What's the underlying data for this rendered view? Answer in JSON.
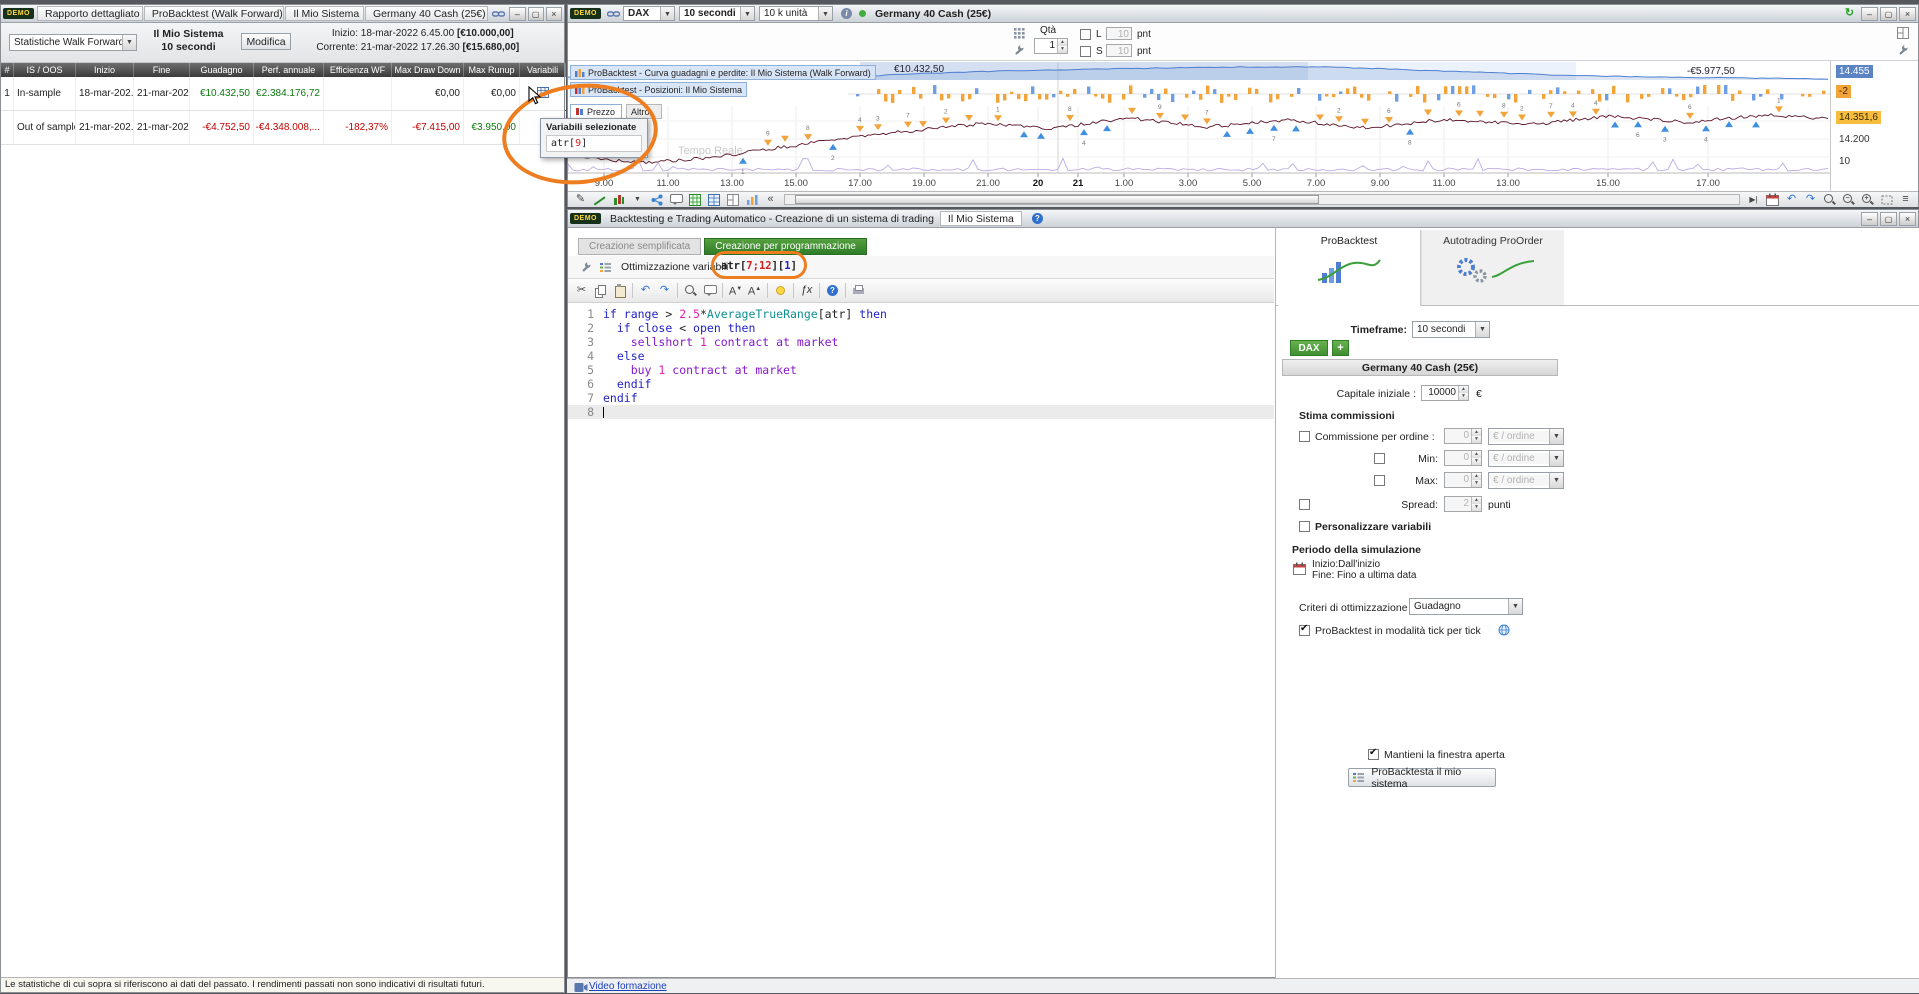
{
  "brand": "DEMO",
  "report_window": {
    "title_tabs": [
      "Rapporto dettagliato",
      "ProBacktest (Walk Forward)",
      "Il Mio Sistema",
      "Germany 40 Cash (25€)"
    ],
    "stats_selector": "Statistiche Walk Forward",
    "system_name": "Il Mio Sistema",
    "system_timeframe": "10 secondi",
    "modify_button": "Modifica",
    "start_label": "Inizio:",
    "start_value": "18-mar-2022 6.45.00",
    "start_capital": "[€10.000,00]",
    "current_label": "Corrente:",
    "current_value": "21-mar-2022 17.26.30",
    "current_capital": "[€15.680,00]",
    "table": {
      "headers": [
        "#",
        "IS / OOS",
        "Inizio",
        "Fine",
        "Guadagno",
        "Perf. annuale",
        "Efficienza WF",
        "Max Draw Down",
        "Max Runup",
        "Variabili"
      ],
      "rows": [
        {
          "num": "1",
          "type": "In-sample",
          "start": "18-mar-202...",
          "end": "21-mar-202...",
          "gain": "€10.432,50",
          "gain_color": "pos",
          "annual": "€2.384.176,72",
          "annual_color": "pos",
          "efficiency": "",
          "efficiency_color": "",
          "dd": "€0,00",
          "dd_color": "",
          "runup": "€0,00",
          "runup_color": "",
          "has_icon": true
        },
        {
          "num": "",
          "type": "Out of sample",
          "start": "21-mar-202...",
          "end": "21-mar-202...",
          "gain": "-€4.752,50",
          "gain_color": "neg",
          "annual": "-€4.348.008,...",
          "annual_color": "neg",
          "efficiency": "-182,37%",
          "efficiency_color": "neg",
          "dd": "-€7.415,00",
          "dd_color": "neg",
          "runup": "€3.950,00",
          "runup_color": "pos",
          "has_icon": false
        }
      ]
    },
    "variables_popup": {
      "title": "Variabili selezionate",
      "item_tokens": [
        [
          "p",
          "atr["
        ],
        [
          "r",
          "9"
        ],
        [
          "p",
          "]"
        ]
      ]
    },
    "disclaimer": "Le statistiche di cui sopra si riferiscono ai dati del passato. I rendimenti passati non sono indicativi di risultati futuri."
  },
  "chart_window": {
    "symbol": "DAX",
    "timeframe": "10 secondi",
    "units": "10 k unità",
    "instrument": "Germany 40 Cash (25€)",
    "qty_label": "Qtà",
    "qty_value": "1",
    "long_label": "L",
    "long_value": "10",
    "short_label": "S",
    "short_value": "10",
    "pnt_label": "pnt",
    "overlay_equity": "ProBacktest - Curva guadagni e perdite: Il Mio Sistema (Walk Forward)",
    "overlay_positions": "ProBacktest - Posizioni: Il Mio Sistema",
    "tab_price": "Prezzo",
    "tab_other": "Altro",
    "equity_gain_label": "€10.432,50",
    "equity_loss_label": "-€5.977,50",
    "watermark": "Tempo Reale",
    "y_labels": [
      {
        "text": "14.455",
        "style": "blue"
      },
      {
        "text": "-2",
        "style": "orange"
      },
      {
        "text": "14.351,6",
        "style": "yellow"
      },
      {
        "text": "14.200",
        "style": "plain"
      },
      {
        "text": "10",
        "style": "plain"
      }
    ],
    "x_ticks": [
      {
        "label": "9.00"
      },
      {
        "label": "11.00"
      },
      {
        "label": "13.00"
      },
      {
        "label": "15.00"
      },
      {
        "label": "17.00"
      },
      {
        "label": "19.00"
      },
      {
        "label": "21.00"
      },
      {
        "label": "20",
        "bold": true
      },
      {
        "label": "21",
        "bold": true
      },
      {
        "label": "1.00"
      },
      {
        "label": "3.00"
      },
      {
        "label": "5.00"
      },
      {
        "label": "7.00"
      },
      {
        "label": "9.00"
      },
      {
        "label": "11.00"
      },
      {
        "label": "13.00"
      },
      {
        "label": "15.00"
      },
      {
        "label": "17.00"
      }
    ],
    "toolbar_left_icons": [
      "draw-icon",
      "trendline-icon",
      "chart-type-icon",
      "chart-type-menu-icon",
      "share-icon",
      "comment-icon",
      "backtest-table-icon",
      "positions-table-icon",
      "layout-icon",
      "statistics-icon",
      "collapse-icon"
    ],
    "toolbar_right_icons": [
      "step-forward-icon",
      "calendar-icon",
      "undo-icon",
      "redo-icon",
      "zoom-reset-icon",
      "zoom-out-icon",
      "zoom-in-icon",
      "zoom-select-icon",
      "menu-icon"
    ],
    "side_icons": [
      "keypad-icon",
      "wrench-icon"
    ]
  },
  "editor_window": {
    "title": "Backtesting e Trading Automatico - Creazione di un sistema di trading",
    "doc_tab": "Il Mio Sistema",
    "tab_simple": "Creazione semplificata",
    "tab_programming": "Creazione per programmazione",
    "optimization_label": "Ottimizzazione variabili",
    "optimization_tokens": [
      [
        "p",
        "atr["
      ],
      [
        "r",
        "7;12"
      ],
      [
        "p",
        "]["
      ],
      [
        "k",
        "1"
      ],
      [
        "p",
        "]"
      ]
    ],
    "toolbar_icons": [
      "cut-icon",
      "copy-icon",
      "paste-icon",
      "undo-icon",
      "redo-icon",
      "search-icon",
      "comment-icon",
      "font-decrease-icon",
      "font-increase-icon",
      "hint-icon",
      "function-icon",
      "help-icon",
      "print-icon"
    ],
    "code_lines": [
      [
        [
          "k",
          "if "
        ],
        [
          "k",
          "range"
        ],
        [
          "p",
          " > "
        ],
        [
          "n",
          "2.5"
        ],
        [
          "p",
          "*"
        ],
        [
          "f",
          "AverageTrueRange"
        ],
        [
          "p",
          "["
        ],
        [
          "p",
          "atr"
        ],
        [
          "p",
          "] "
        ],
        [
          "k",
          "then"
        ]
      ],
      [
        [
          "p",
          "  "
        ],
        [
          "k",
          "if "
        ],
        [
          "k",
          "close"
        ],
        [
          "p",
          " < "
        ],
        [
          "k",
          "open"
        ],
        [
          "p",
          " "
        ],
        [
          "k",
          "then"
        ]
      ],
      [
        [
          "p",
          "    "
        ],
        [
          "o",
          "sellshort "
        ],
        [
          "n",
          "1"
        ],
        [
          "o",
          " contract at market"
        ]
      ],
      [
        [
          "p",
          "  "
        ],
        [
          "k",
          "else"
        ]
      ],
      [
        [
          "p",
          "    "
        ],
        [
          "o",
          "buy "
        ],
        [
          "n",
          "1"
        ],
        [
          "o",
          " contract at market"
        ]
      ],
      [
        [
          "p",
          "  "
        ],
        [
          "k",
          "endif"
        ]
      ],
      [
        [
          "k",
          "endif"
        ]
      ],
      []
    ]
  },
  "config_panel": {
    "tab_probacktest": "ProBacktest",
    "tab_proorder": "Autotrading ProOrder",
    "timeframe_label": "Timeframe:",
    "timeframe_value": "10 secondi",
    "symbol_tab": "DAX",
    "instrument_header": "Germany 40 Cash (25€)",
    "capital_label": "Capitale iniziale :",
    "capital_value": "10000",
    "capital_currency": "€",
    "commissions_title": "Stima commissioni",
    "commission_label": "Commissione per ordine :",
    "commission_value": "0",
    "per_order_unit": "€ / ordine",
    "min_label": "Min:",
    "min_value": "0",
    "max_label": "Max:",
    "max_value": "0",
    "spread_label": "Spread:",
    "spread_value": "2",
    "spread_unit": "punti",
    "custom_variables_label": "Personalizzare variabili",
    "simulation_title": "Periodo della simulazione",
    "simulation_start": "Inizio:Dall'inizio",
    "simulation_end": "Fine: Fino a ultima data",
    "criteria_label": "Criteri di ottimizzazione :",
    "criteria_value": "Guadagno",
    "tick_mode_label": "ProBacktest in modalità tick per tick",
    "keep_window_label": "Mantieni la finestra aperta",
    "run_button": "ProBacktesta il mio sistema"
  },
  "footer": {
    "video_link": "Video formazione"
  }
}
